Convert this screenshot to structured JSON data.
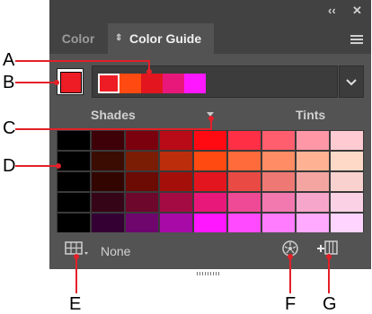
{
  "titlebar": {
    "collapse_icon": "double-chevron-left-icon",
    "close_icon": "close-icon"
  },
  "tabs": [
    {
      "label": "Color"
    },
    {
      "label": "Color Guide"
    }
  ],
  "panel_menu_icon": "menu-icon",
  "base_color": "#ee1c25",
  "harmony_colors": [
    "#ee1c25",
    "#ff4a11",
    "#e3151e",
    "#e8187a",
    "#ff17ff"
  ],
  "section_labels": {
    "shades": "Shades",
    "tints": "Tints"
  },
  "grid_colors": [
    [
      "#000000",
      "#3d0107",
      "#7c010f",
      "#b80b17",
      "#ff0a13",
      "#ff2f45",
      "#ff5e6e",
      "#ff97a6",
      "#ffcad1"
    ],
    [
      "#000000",
      "#3b0c02",
      "#7b1d05",
      "#bc2d0c",
      "#ff4a11",
      "#ff6b3a",
      "#ff8c64",
      "#ffb293",
      "#ffd9c8"
    ],
    [
      "#000000",
      "#320501",
      "#6c0a04",
      "#a40f0a",
      "#e3151e",
      "#e94a44",
      "#ee7874",
      "#f4a5a2",
      "#f9d2d0"
    ],
    [
      "#000000",
      "#360417",
      "#6e072c",
      "#a50b43",
      "#e8187a",
      "#ee4a95",
      "#f278b0",
      "#f7a6cb",
      "#fbd2e5"
    ],
    [
      "#000000",
      "#340034",
      "#6e066e",
      "#a70aa7",
      "#ff17ff",
      "#ff4aff",
      "#ff7cff",
      "#ffa9ff",
      "#ffd4ff"
    ]
  ],
  "bottom": {
    "none_label": "None",
    "swatch_icon": "color-swatches-icon",
    "edit_colors_icon": "edit-colors-icon",
    "save_group_icon": "save-color-group-icon"
  },
  "callouts": [
    "A",
    "B",
    "C",
    "D",
    "E",
    "F",
    "G"
  ]
}
